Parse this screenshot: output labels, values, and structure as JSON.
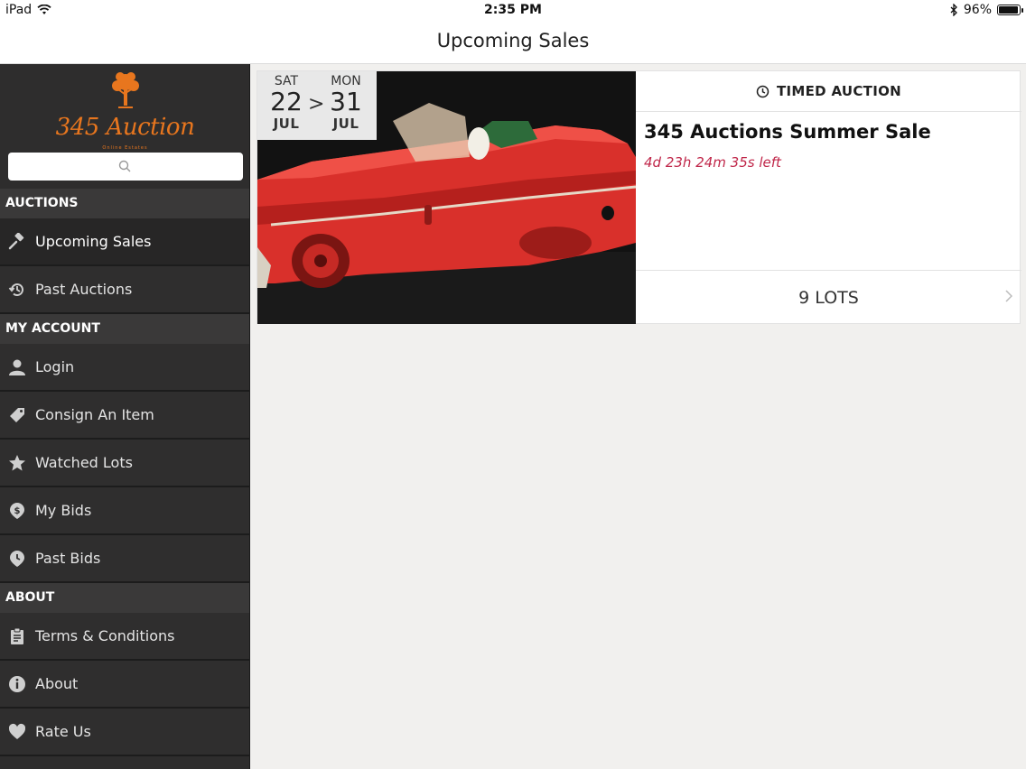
{
  "status_bar": {
    "device": "iPad",
    "time": "2:35 PM",
    "battery": "96%"
  },
  "nav": {
    "title": "Upcoming Sales"
  },
  "sidebar": {
    "logo_text": "345 Auction",
    "logo_subtitle": "Online Estates",
    "search_placeholder": "",
    "sections": {
      "auctions": "AUCTIONS",
      "my_account": "MY ACCOUNT",
      "about": "ABOUT"
    },
    "items": {
      "upcoming_sales": "Upcoming Sales",
      "past_auctions": "Past Auctions",
      "login": "Login",
      "consign": "Consign An Item",
      "watched_lots": "Watched Lots",
      "my_bids": "My Bids",
      "past_bids": "Past Bids",
      "terms": "Terms & Conditions",
      "about": "About",
      "rate_us": "Rate Us"
    }
  },
  "sale": {
    "start_dow": "SAT",
    "start_day": "22",
    "start_month": "JUL",
    "separator": ">",
    "end_dow": "MON",
    "end_day": "31",
    "end_month": "JUL",
    "type": "TIMED AUCTION",
    "title": "345 Auctions Summer Sale",
    "time_left": "4d 23h 24m 35s left",
    "lots": "9 LOTS"
  },
  "colors": {
    "accent_orange": "#e8761e",
    "time_left_red": "#c0274a",
    "sidebar_bg": "#2e2d2d"
  }
}
